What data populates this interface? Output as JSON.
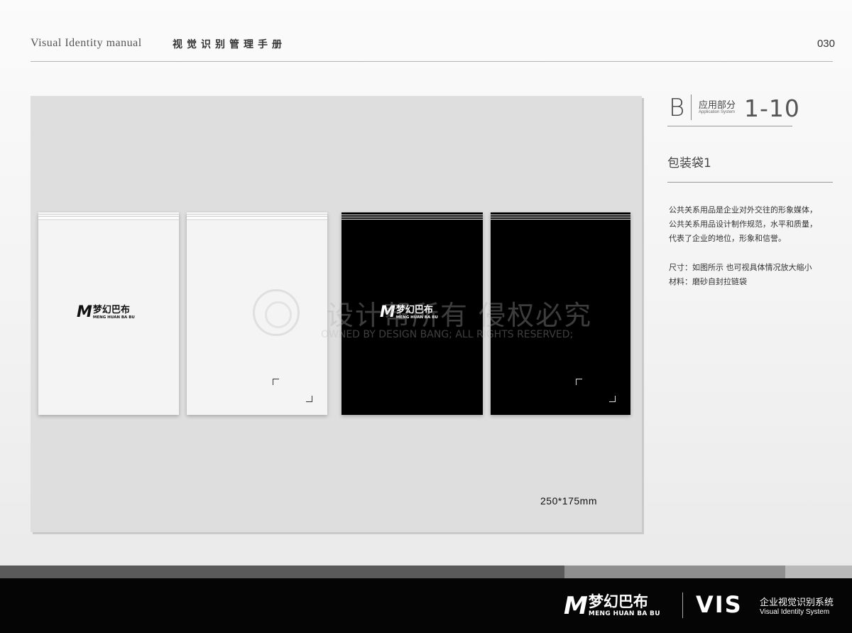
{
  "header": {
    "title_en": "Visual Identity  manual",
    "title_cn": "视觉识别管理手册",
    "page_number": "030"
  },
  "section": {
    "letter": "B",
    "name_cn": "应用部分",
    "name_en": "Application System",
    "number": "1-10"
  },
  "item": {
    "title": "包装袋1",
    "description_lines": [
      "公共关系用品是企业对外交往的形象媒体，",
      "公共关系用品设计制作规范，水平和质量，",
      "代表了企业的地位，形象和信誉。"
    ],
    "size_note": "尺寸：如图所示 也可视具体情况放大缩小",
    "material_note": "材料：磨砂自封拉链袋"
  },
  "artwork": {
    "dimension_label": "250*175mm",
    "logo": {
      "mark": "M",
      "name_cn": "梦幻巴布",
      "name_en": "MENG HUAN BA BU"
    }
  },
  "watermark": {
    "cn": "设计帮所有 侵权必究",
    "en": "OWNED BY DESIGN BANG; ALL RIGHTS RESERVED;"
  },
  "footer": {
    "logo_mark": "M",
    "logo_cn": "梦幻巴布",
    "logo_en": "MENG HUAN BA BU",
    "vis_label": "VIS",
    "system_cn": "企业视觉识别系统",
    "system_en": "Visual Identity System"
  }
}
